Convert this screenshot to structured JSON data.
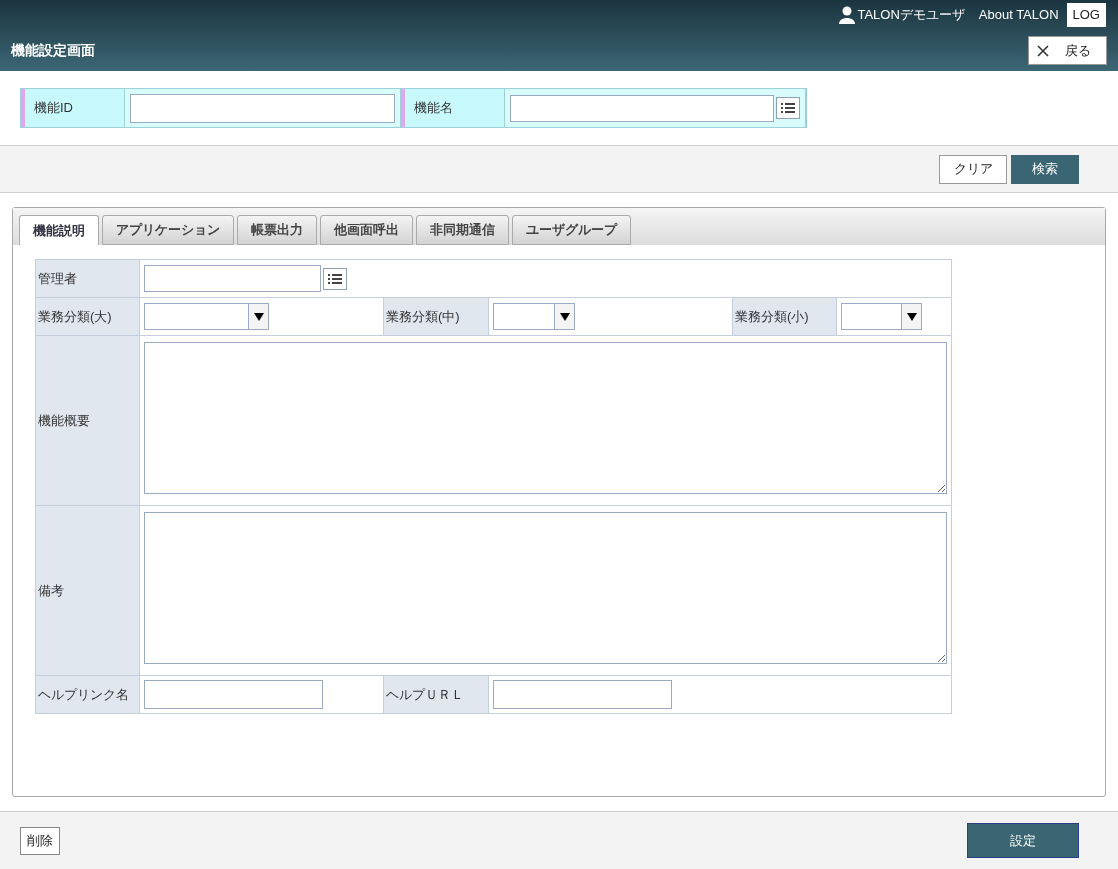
{
  "header": {
    "user": "TALONデモユーザ",
    "about": "About TALON",
    "log_button": "LOG",
    "title": "機能設定画面",
    "back_button": "戻る"
  },
  "search_fields": [
    {
      "label": "機能ID",
      "kind": "text"
    },
    {
      "label": "機能名",
      "kind": "lookup"
    }
  ],
  "search_buttons": {
    "clear": "クリア",
    "search": "検索"
  },
  "tabs": [
    {
      "label": "機能説明",
      "selected": true
    },
    {
      "label": "アプリケーション",
      "selected": false
    },
    {
      "label": "帳票出力",
      "selected": false
    },
    {
      "label": "他画面呼出",
      "selected": false
    },
    {
      "label": "非同期通信",
      "selected": false
    },
    {
      "label": "ユーザグループ",
      "selected": false
    }
  ],
  "form_rows": [
    {
      "kind": "single",
      "fields": [
        {
          "label": "管理者",
          "kind": "lookup"
        }
      ]
    },
    {
      "kind": "triple",
      "fields": [
        {
          "label": "業務分類(大)",
          "kind": "select"
        },
        {
          "label": "業務分類(中)",
          "kind": "select"
        },
        {
          "label": "業務分類(小)",
          "kind": "select"
        }
      ]
    },
    {
      "kind": "single",
      "fields": [
        {
          "label": "機能概要",
          "kind": "textarea"
        }
      ]
    },
    {
      "kind": "single",
      "fields": [
        {
          "label": "備考",
          "kind": "textarea"
        }
      ]
    },
    {
      "kind": "double",
      "fields": [
        {
          "label": "ヘルプリンク名",
          "kind": "text"
        },
        {
          "label": "ヘルプＵＲＬ",
          "kind": "text"
        }
      ]
    }
  ],
  "footer": {
    "delete_button": "削除",
    "submit_button": "設定"
  }
}
